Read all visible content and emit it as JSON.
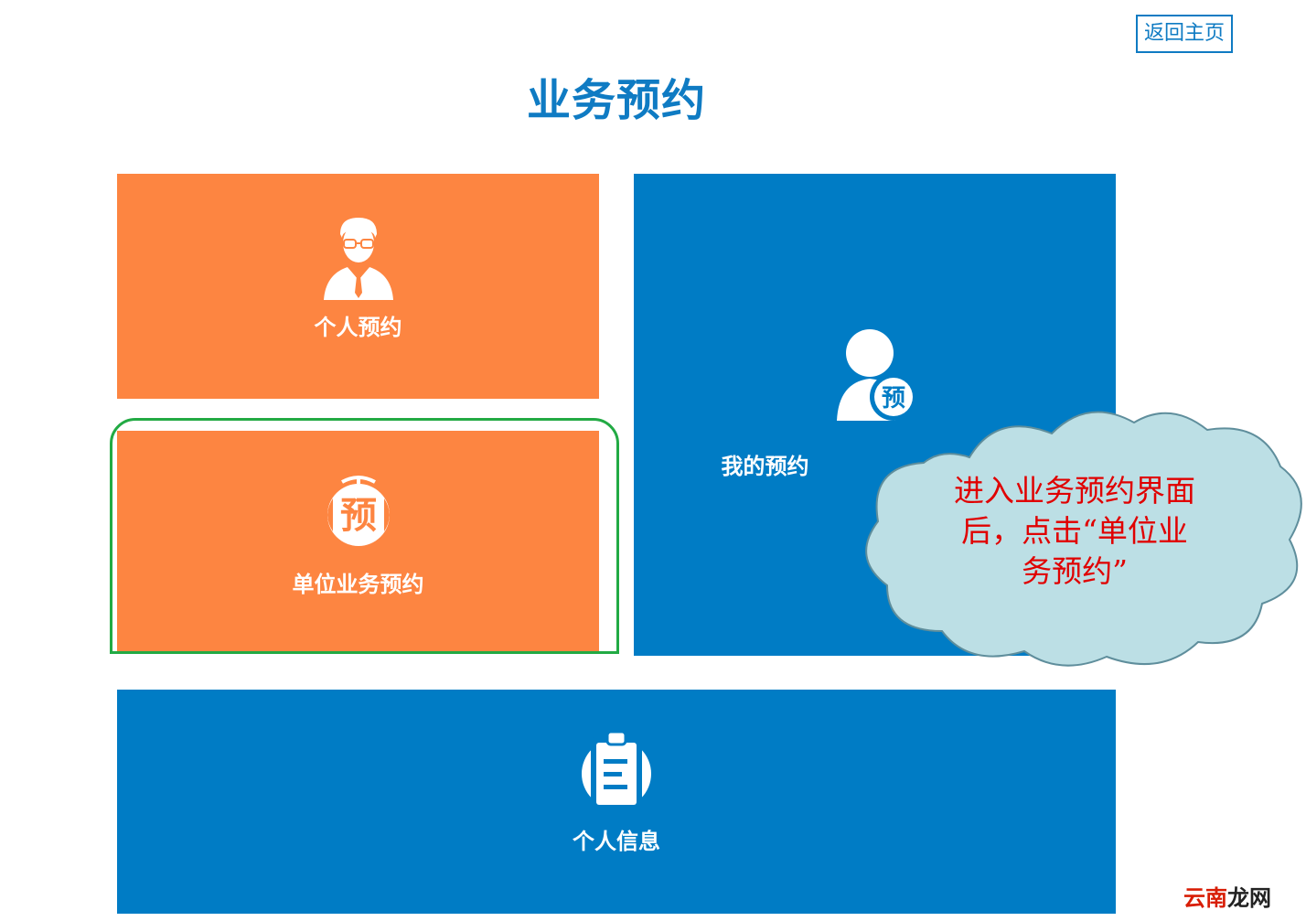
{
  "header": {
    "home_button": "返回主页",
    "title": "业务预约"
  },
  "tiles": {
    "personal": {
      "label": "个人预约",
      "icon": "businessman-icon",
      "color": "#fd8541"
    },
    "unit": {
      "label": "单位业务预约",
      "icon": "reserve-badge-icon",
      "color": "#fd8541"
    },
    "mine": {
      "label": "我的预约",
      "icon": "user-reserve-icon",
      "color": "#007cc5",
      "badge": "预"
    },
    "info": {
      "label": "个人信息",
      "icon": "clipboard-icon",
      "color": "#007cc5"
    }
  },
  "unit_badge_char": "预",
  "callout": {
    "lines": [
      "进入业务预约界面",
      "后，点击“单位业",
      "务预约”"
    ],
    "highlight_color": "#22aa44",
    "cloud_color": "#bcdfe5"
  },
  "watermark": {
    "part1": "云南",
    "part2": "龙网"
  }
}
